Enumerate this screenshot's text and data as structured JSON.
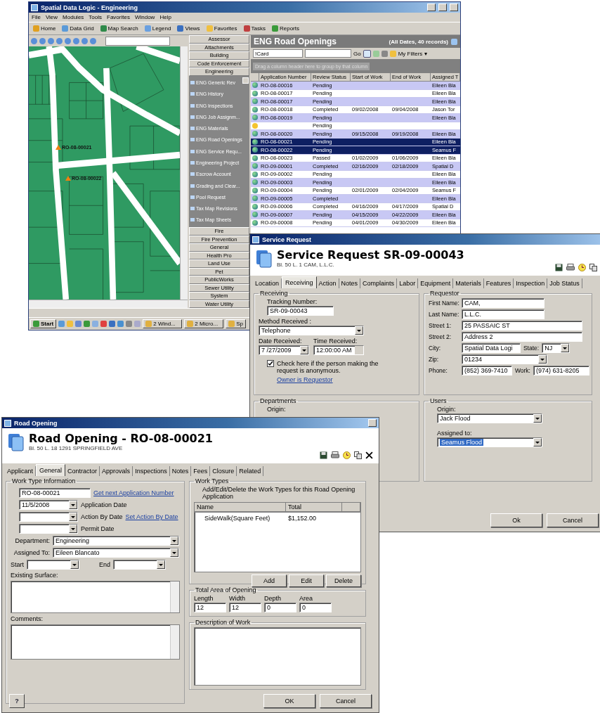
{
  "main_window": {
    "title": "Spatial Data Logic - Engineering",
    "menu": [
      "File",
      "View",
      "Modules",
      "Tools",
      "Favorites",
      "Window",
      "Help"
    ],
    "toolbar": [
      "Home",
      "Data Grid",
      "Map Search",
      "Legend",
      "Views",
      "Favorites",
      "Tasks",
      "Reports"
    ],
    "map": {
      "markers": [
        {
          "label": "RO-08-00021"
        },
        {
          "label": "RO-08-00022"
        }
      ]
    },
    "sidebar": {
      "groups_above": [
        "Assessor",
        "Attachments",
        "Building",
        "Code Enforcement"
      ],
      "open_group": {
        "label": "Engineering",
        "items": [
          "ENG Generic Rev",
          "ENG History",
          "ENG Inspections",
          "ENG Job Assignm...",
          "ENG Materials",
          "ENG Road Openings",
          "ENG Service Requ...",
          "Engineering Project",
          "Escrow Account",
          "Grading and Clear...",
          "Pool Request",
          "Tax Map Revisions",
          "Tax Map Sheets"
        ]
      },
      "groups_below": [
        "Fire",
        "Fire Prevention",
        "General",
        "Health Pro",
        "Land Use",
        "Pet",
        "PublicWorks",
        "Sewer Utility",
        "System",
        "Water Utility"
      ]
    },
    "grid": {
      "title": "ENG Road Openings",
      "summary": "(All Dates, 40 records)",
      "filter": {
        "field": "!Card",
        "go": "Go",
        "my_filters": "My Filters ▾"
      },
      "group_hint": "Drag a column header here to group by that column",
      "columns": [
        "Application Number",
        "Review Status",
        "Start of Work",
        "End of Work",
        "Assigned T"
      ],
      "rows": [
        {
          "kind": "globe",
          "selected": false,
          "cells": [
            "RO-08-00016",
            "Pending",
            "",
            "",
            "Eileen Bla"
          ]
        },
        {
          "kind": "globe",
          "selected": false,
          "cells": [
            "RO-08-00017",
            "Pending",
            "",
            "",
            "Eileen Bla"
          ]
        },
        {
          "kind": "globe",
          "selected": false,
          "cells": [
            "RO-08-00017",
            "Pending",
            "",
            "",
            "Eileen Bla"
          ]
        },
        {
          "kind": "globe",
          "selected": false,
          "cells": [
            "RO-08-00018",
            "Completed",
            "09/02/2008",
            "09/04/2008",
            "Jason Tor"
          ]
        },
        {
          "kind": "globe",
          "selected": false,
          "cells": [
            "RO-08-00019",
            "Pending",
            "",
            "",
            "Eileen Bla"
          ]
        },
        {
          "kind": "smiley",
          "selected": false,
          "cells": [
            "",
            "Pending",
            "",
            "",
            ""
          ]
        },
        {
          "kind": "globe",
          "selected": false,
          "cells": [
            "RO-08-00020",
            "Pending",
            "09/15/2008",
            "09/19/2008",
            "Eileen Bla"
          ]
        },
        {
          "kind": "globe",
          "selected": true,
          "cells": [
            "RO-08-00021",
            "Pending",
            "",
            "",
            "Eileen Bla"
          ]
        },
        {
          "kind": "globe",
          "selected": true,
          "cells": [
            "RO-08-00022",
            "Pending",
            "",
            "",
            "Seamus F"
          ]
        },
        {
          "kind": "globe",
          "selected": false,
          "cells": [
            "RO-08-00023",
            "Passed",
            "01/02/2009",
            "01/06/2009",
            "Eileen Bla"
          ]
        },
        {
          "kind": "globe",
          "selected": false,
          "cells": [
            "RO-09-00001",
            "Completed",
            "02/16/2009",
            "02/18/2009",
            "Spatial D"
          ]
        },
        {
          "kind": "globe",
          "selected": false,
          "cells": [
            "RO-09-00002",
            "Pending",
            "",
            "",
            "Eileen Bla"
          ]
        },
        {
          "kind": "globe",
          "selected": false,
          "cells": [
            "RO-09-00003",
            "Pending",
            "",
            "",
            "Eileen Bla"
          ]
        },
        {
          "kind": "globe",
          "selected": false,
          "cells": [
            "RO-09-00004",
            "Pending",
            "02/01/2009",
            "02/04/2009",
            "Seamus F"
          ]
        },
        {
          "kind": "globe",
          "selected": false,
          "cells": [
            "RO-09-00005",
            "Completed",
            "",
            "",
            "Eileen Bla"
          ]
        },
        {
          "kind": "globe",
          "selected": false,
          "cells": [
            "RO-09-00006",
            "Completed",
            "04/16/2009",
            "04/17/2009",
            "Spatial D"
          ]
        },
        {
          "kind": "globe",
          "selected": false,
          "cells": [
            "RO-09-00007",
            "Pending",
            "04/15/2009",
            "04/22/2009",
            "Eileen Bla"
          ]
        },
        {
          "kind": "globe",
          "selected": false,
          "cells": [
            "RO-09-00008",
            "Pending",
            "04/01/2009",
            "04/30/2009",
            "Eileen Bla"
          ]
        }
      ]
    },
    "taskbar": {
      "start": "Start",
      "buttons": [
        "2 Wind...",
        "2 Micro...",
        "Sp"
      ]
    }
  },
  "service_request": {
    "title": "Service Request",
    "heading": "Service Request SR-09-00043",
    "subtitle": "Bl. 50 L. 1  CAM, L.L.C.",
    "tabs": [
      {
        "label": "Location",
        "selected": false
      },
      {
        "label": "Receiving",
        "selected": true
      },
      {
        "label": "Action",
        "selected": false
      },
      {
        "label": "Notes",
        "selected": false
      },
      {
        "label": "Complaints",
        "selected": false
      },
      {
        "label": "Labor",
        "selected": false
      },
      {
        "label": "Equipment",
        "selected": false
      },
      {
        "label": "Materials",
        "selected": false
      },
      {
        "label": "Features",
        "selected": false
      },
      {
        "label": "Inspection",
        "selected": false
      },
      {
        "label": "Job Status",
        "selected": false
      }
    ],
    "receiving": {
      "legend": "Receiving",
      "tracking_label": "Tracking Number:",
      "tracking_number": "SR-09-00043",
      "method_label": "Method Received :",
      "method": "Telephone",
      "date_label": "Date Received:",
      "date": "7 /27/2009",
      "time_label": "Time Received:",
      "time": "12:00:00 AM",
      "anonymous": {
        "label": "Check here if the person making the request is anonymous.",
        "checked": true
      },
      "owner_link": "Owner is Requestor"
    },
    "requestor": {
      "legend": "Requestor",
      "first_name_label": "First Name:",
      "first_name": "CAM,",
      "last_name_label": "Last Name:",
      "last_name": "L.L.C.",
      "street1_label": "Street 1:",
      "street1": "25 PASSAIC ST",
      "street2_label": "Street 2:",
      "street2": "Address 2",
      "city_label": "City:",
      "city": "Spatial Data Logi",
      "state_label": "State:",
      "state": "NJ",
      "zip_label": "Zip:",
      "zip": "01234",
      "phone_label": "Phone:",
      "phone": "(852) 369-7410",
      "work_label": "Work:",
      "work": "(974) 631-8205"
    },
    "departments": {
      "legend": "Departments",
      "origin_label": "Origin:"
    },
    "users": {
      "legend": "Users",
      "origin_label": "Origin:",
      "origin": {
        "value": "Jack Flood",
        "highlighted": false
      },
      "assigned_label": "Assigned to:",
      "assigned": {
        "value": "Seamus Flood",
        "highlighted": true
      }
    },
    "buttons": [
      "Ok",
      "Cancel"
    ]
  },
  "road_opening": {
    "title": "Road Opening",
    "heading": "Road Opening - RO-08-00021",
    "subtitle": "Bl. 50 L. 18  1291 SPRINGFIELD AVE",
    "tabs": [
      {
        "label": "Applicant",
        "selected": false
      },
      {
        "label": "General",
        "selected": true
      },
      {
        "label": "Contractor",
        "selected": false
      },
      {
        "label": "Approvals",
        "selected": false
      },
      {
        "label": "Inspections",
        "selected": false
      },
      {
        "label": "Notes",
        "selected": false
      },
      {
        "label": "Fees",
        "selected": false
      },
      {
        "label": "Closure",
        "selected": false
      },
      {
        "label": "Related",
        "selected": false
      }
    ],
    "work_type_info": {
      "legend": "Work Type Information",
      "application_number": "RO-08-00021",
      "next_number_link": "Get next Application Number",
      "application_date": "11/5/2008",
      "application_date_label": "Application Date",
      "action_by_label": "Action By Date",
      "action_by_link": "Set Action By Date",
      "permit_label": "Permit Date",
      "department_label": "Department:",
      "department": "Engineering",
      "assigned_label": "Assigned To:",
      "assigned": "Eileen Blancato",
      "start_label": "Start",
      "end_label": "End",
      "surface_label": "Existing Surface:",
      "comments_label": "Comments:"
    },
    "work_types": {
      "legend": "Work Types",
      "description": "Add/Edit/Delete the Work Types for this Road Opening Application",
      "columns": [
        "Name",
        "Total"
      ],
      "rows": [
        [
          "SideWalk(Square Feet)",
          "$1,152.00"
        ]
      ],
      "buttons": [
        "Add",
        "Edit",
        "Delete"
      ]
    },
    "total_area": {
      "legend": "Total Area of Opening",
      "fields": [
        {
          "label": "Length",
          "value": "12"
        },
        {
          "label": "Width",
          "value": "12"
        },
        {
          "label": "Depth",
          "value": "0"
        },
        {
          "label": "Area",
          "value": "0"
        }
      ]
    },
    "description": {
      "legend": "Description of Work"
    },
    "help": "?",
    "buttons": [
      "OK",
      "Cancel"
    ]
  }
}
